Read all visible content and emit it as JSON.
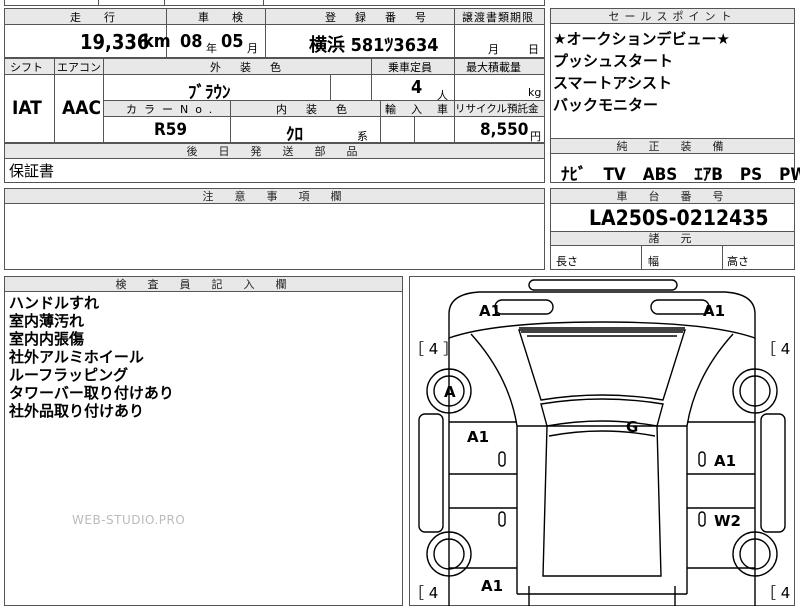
{
  "header": {
    "mileage_label": "走　行",
    "inspection_label": "車　検",
    "registration_label": "登　録　番　号",
    "transfer_docs_label": "譲渡書類期限",
    "mileage_value": "19,336",
    "mileage_unit": "km",
    "inspection_year": "08",
    "inspection_year_unit": "年",
    "inspection_month": "05",
    "inspection_month_unit": "月",
    "registration_value": "横浜 581ﾂ3634",
    "transfer_month_unit": "月",
    "transfer_day_unit": "日"
  },
  "specs": {
    "shift_label": "シフト",
    "aircon_label": "エアコン",
    "ext_color_label": "外　装　色",
    "capacity_label": "乗車定員",
    "max_load_label": "最大積載量",
    "shift_value": "IAT",
    "aircon_value": "AAC",
    "ext_color_value": "ﾌﾞﾗｳﾝ",
    "capacity_value": "4",
    "capacity_unit": "人",
    "max_load_unit": "kg",
    "color_no_label": "カラーNo.",
    "int_color_label": "内　装　色",
    "import_label": "輸　入　車",
    "recycle_label": "リサイクル預託金",
    "color_no_value": "R59",
    "int_color_value": "ｸﾛ",
    "int_color_suffix": "系",
    "recycle_value": "8,550",
    "recycle_unit": "円"
  },
  "later_parts": {
    "label": "後　日　発　送　部　品",
    "value": "保証書"
  },
  "notes": {
    "label": "注　意　事　項　欄"
  },
  "sales_points": {
    "label": "セールスポイント",
    "items": [
      "★オークションデビュー★",
      "プッシュスタート",
      "スマートアシスト",
      "バックモニター"
    ]
  },
  "equipment": {
    "label": "純　正　装　備",
    "value": "ﾅﾋﾞ　TV　ABS　ｴｱB　PS　PW"
  },
  "chassis": {
    "label": "車　台　番　号",
    "value": "LA250S-0212435"
  },
  "dimensions": {
    "label": "諸　元",
    "length_label": "長さ",
    "width_label": "幅",
    "height_label": "高さ"
  },
  "inspector": {
    "label": "検　査　員　記　入　欄",
    "items": [
      "ハンドルすれ",
      "室内薄汚れ",
      "室内内張傷",
      "社外アルミホイール",
      "ルーフラッピング",
      "タワーバー取り付けあり",
      "社外品取り付けあり"
    ]
  },
  "watermark": "WEB-STUDIO.PRO",
  "diagram": {
    "tire_tl": "［ 4 ］",
    "tire_tr": "［ 4 ］",
    "tire_bl": "［ 4",
    "tire_br": "［ 4",
    "mark_front_left": "A1",
    "mark_front_right": "A1",
    "mark_wheel_left": "A",
    "mark_door_fl": "A1",
    "mark_roof": "G",
    "mark_door_fr": "A1",
    "mark_door_rr": "W2",
    "mark_rear_left": "A1"
  }
}
